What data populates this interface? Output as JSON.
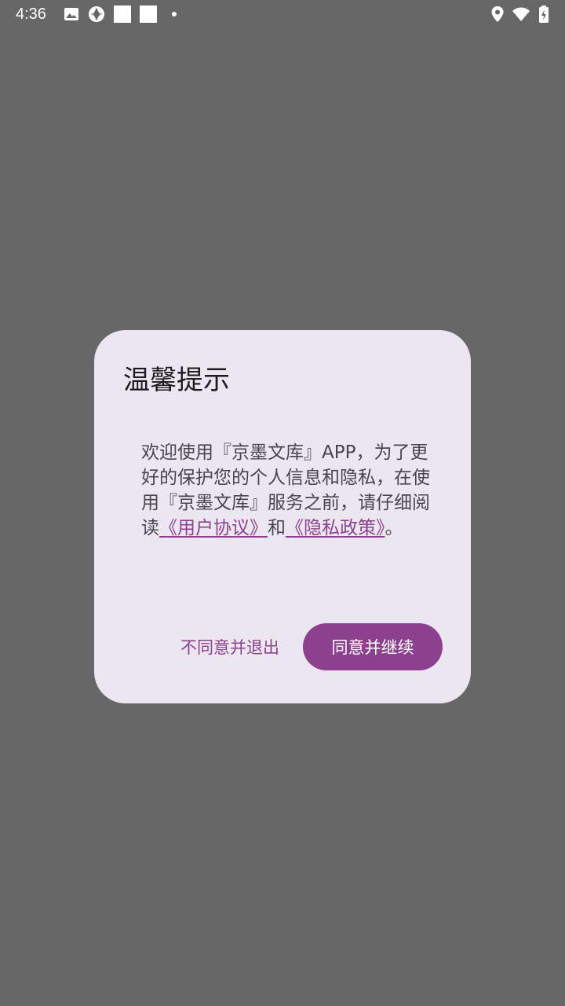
{
  "status_bar": {
    "time": "4:36",
    "left_icons": [
      "image-icon",
      "sync-icon",
      "blank-square-icon",
      "blank-square-icon",
      "dot-icon"
    ],
    "right_icons": [
      "location-icon",
      "wifi-icon",
      "battery-charging-icon"
    ]
  },
  "dialog": {
    "title": "温馨提示",
    "body": {
      "text_before": "欢迎使用『京墨文库』APP，为了更好的保护您的个人信息和隐私，在使用『京墨文库』服务之前，请仔细阅读",
      "user_agreement_link": "《用户协议》",
      "conjunction": "和",
      "privacy_policy_link": "《隐私政策》",
      "text_end": "。"
    },
    "decline_button": "不同意并退出",
    "accept_button": "同意并继续"
  },
  "colors": {
    "background": "#676767",
    "dialog_bg": "#ece6f1",
    "accent": "#8b418d",
    "title_text": "#1d1b20",
    "body_text": "#49454f"
  }
}
